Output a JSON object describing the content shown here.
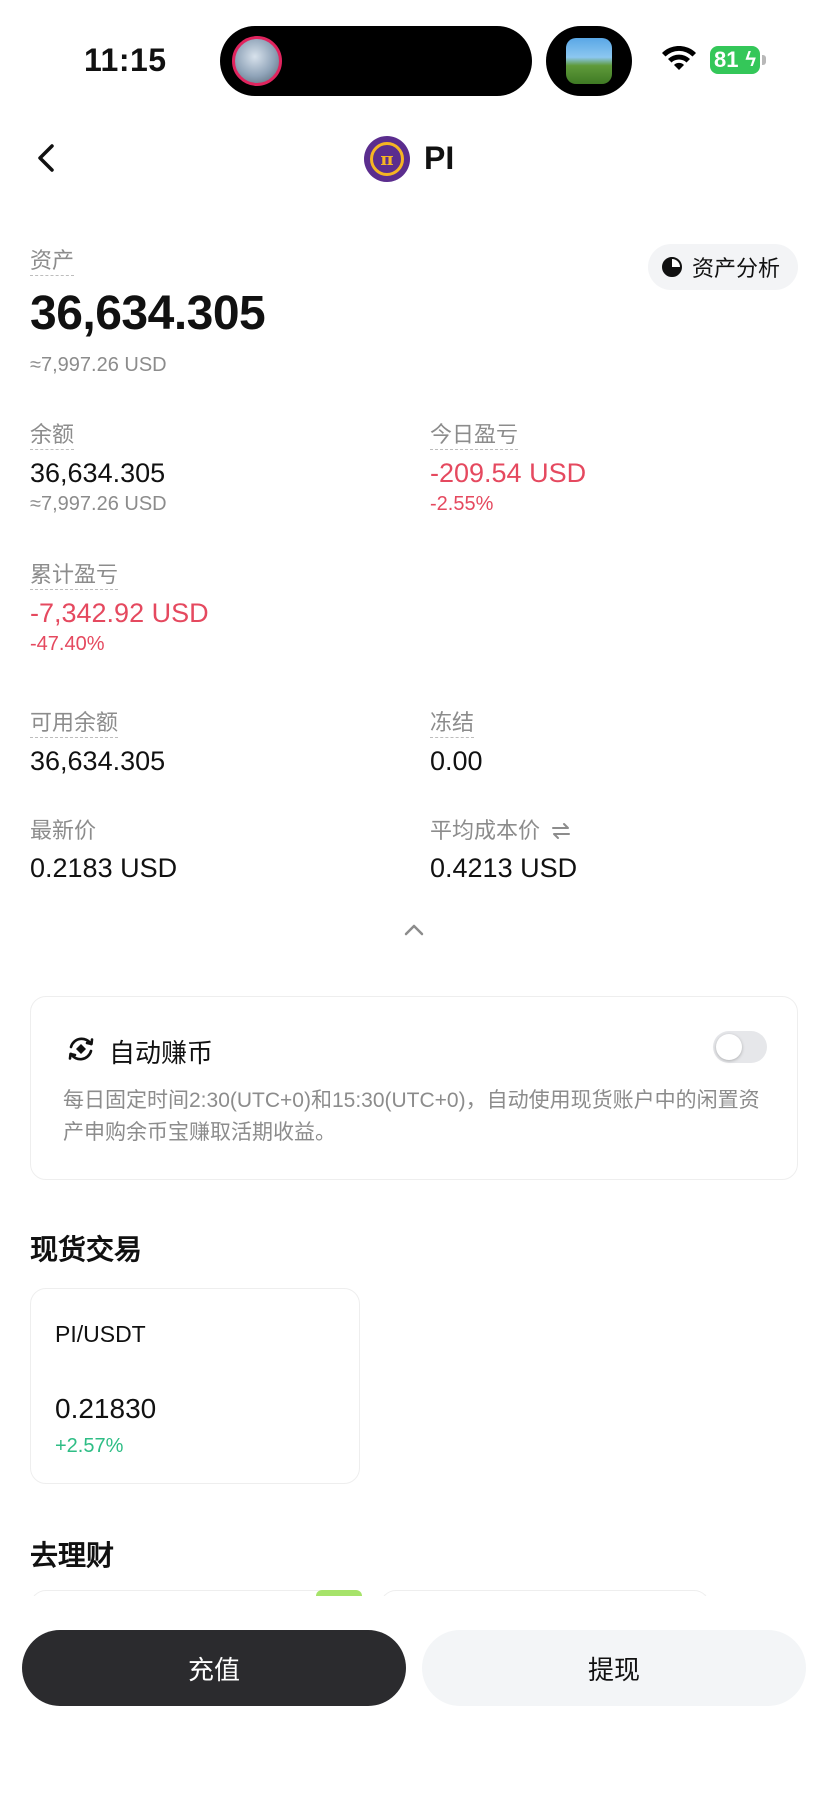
{
  "status_bar": {
    "time": "11:15",
    "battery": "81"
  },
  "header": {
    "title": "PI",
    "coin_symbol": "π"
  },
  "asset": {
    "label": "资产",
    "value": "36,634.305",
    "usd": "≈7,997.26 USD",
    "analysis_button": "资产分析"
  },
  "balance": {
    "label": "余额",
    "value": "36,634.305",
    "usd": "≈7,997.26 USD"
  },
  "today_pnl": {
    "label": "今日盈亏",
    "value": "-209.54 USD",
    "percent": "-2.55%"
  },
  "total_pnl": {
    "label": "累计盈亏",
    "value": "-7,342.92 USD",
    "percent": "-47.40%"
  },
  "available": {
    "label": "可用余额",
    "value": "36,634.305"
  },
  "frozen": {
    "label": "冻结",
    "value": "0.00"
  },
  "latest_price": {
    "label": "最新价",
    "value": "0.2183 USD"
  },
  "avg_cost": {
    "label": "平均成本价",
    "value": "0.4213 USD"
  },
  "auto_earn": {
    "title": "自动赚币",
    "enabled": false,
    "description": "每日固定时间2:30(UTC+0)和15:30(UTC+0)，自动使用现货账户中的闲置资产申购余币宝赚取活期收益。"
  },
  "spot": {
    "title": "现货交易",
    "pair": {
      "name": "PI/USDT",
      "price": "0.21830",
      "change": "+2.57%"
    }
  },
  "finance": {
    "title": "去理财"
  },
  "actions": {
    "deposit": "充值",
    "withdraw": "提现"
  },
  "colors": {
    "negative": "#e5495f",
    "positive": "#2ebd85",
    "primary_button": "#2b2b2e",
    "coin": "#5b2d8e"
  }
}
